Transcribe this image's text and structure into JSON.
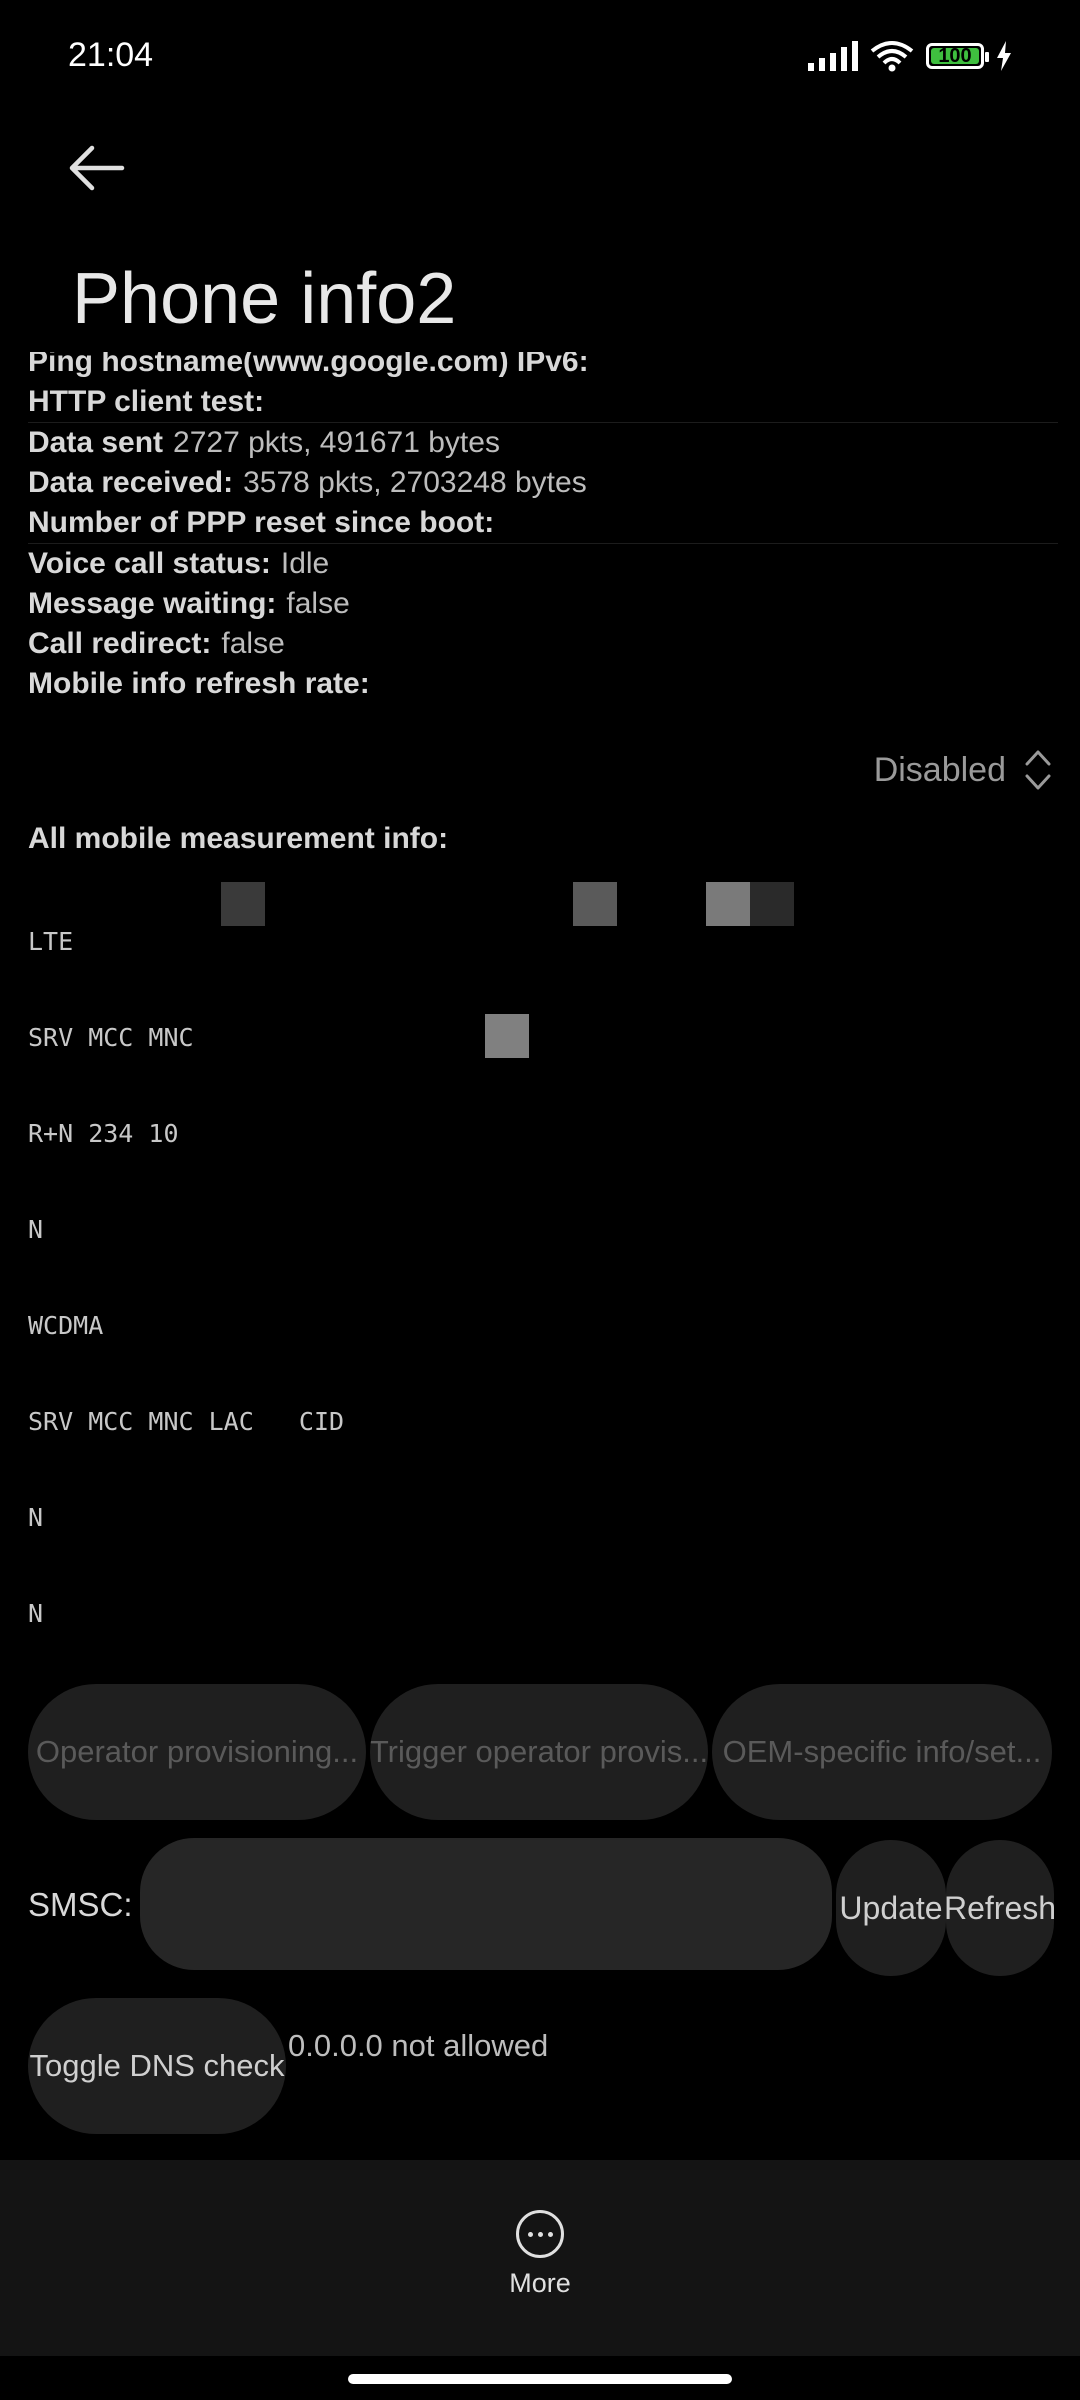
{
  "status_bar": {
    "time": "21:04",
    "battery": "100"
  },
  "header": {
    "title": "Phone info2"
  },
  "info_rows": [
    {
      "label": "Ping hostname(www.google.com) IPv6:",
      "value": ""
    },
    {
      "label": "HTTP client test:",
      "value": ""
    },
    {
      "label": "Data sent",
      "value": "2727 pkts, 491671 bytes"
    },
    {
      "label": "Data received:",
      "value": "3578 pkts, 2703248 bytes"
    },
    {
      "label": "Number of PPP reset since boot:",
      "value": ""
    },
    {
      "label": "Voice call status:",
      "value": "Idle"
    },
    {
      "label": "Message waiting:",
      "value": "false"
    },
    {
      "label": "Call redirect:",
      "value": "false"
    },
    {
      "label": "Mobile info refresh rate:",
      "value": ""
    }
  ],
  "refresh_rate": {
    "selected": "Disabled"
  },
  "measurement": {
    "title": "All mobile measurement info:",
    "lines": [
      "LTE",
      "SRV MCC MNC",
      "R+N 234 10",
      "N",
      "WCDMA",
      "SRV MCC MNC LAC   CID",
      "N",
      "N"
    ]
  },
  "buttons": {
    "operator_provisioning": "Operator provisioning...",
    "trigger_provisioning": "Trigger operator provis...",
    "oem_info": "OEM-specific info/set..."
  },
  "smsc": {
    "label": "SMSC:",
    "value": "",
    "update": "Update",
    "refresh": "Refresh"
  },
  "dns": {
    "toggle": "Toggle DNS check",
    "status": "0.0.0.0 not allowed"
  },
  "bottom": {
    "more": "More"
  }
}
